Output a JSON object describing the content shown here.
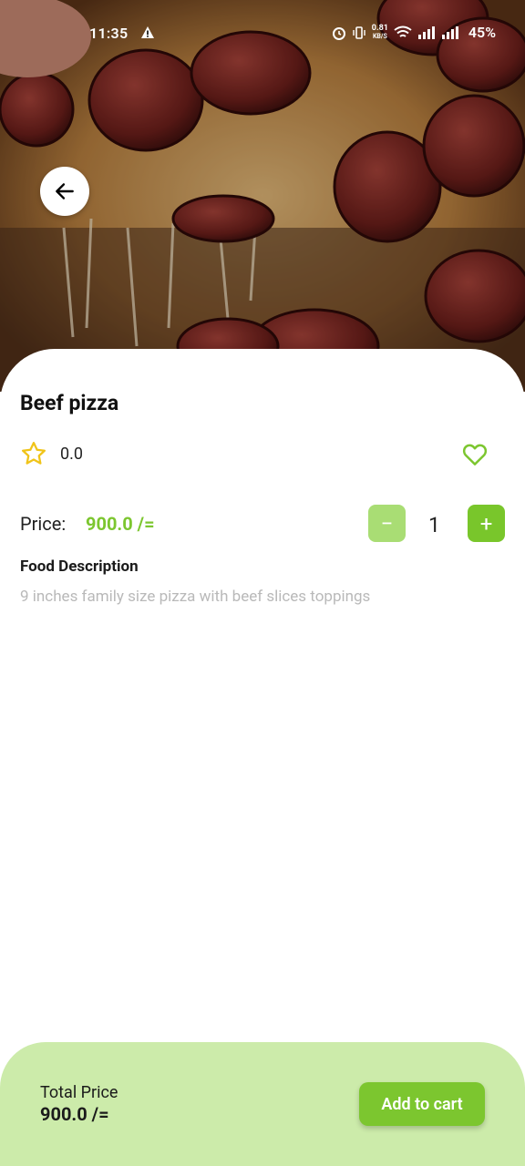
{
  "status_bar": {
    "time": "11:35",
    "network_speed_value": "0.81",
    "network_speed_unit": "KB/S",
    "battery": "45%"
  },
  "product": {
    "name": "Beef pizza",
    "rating": "0.0",
    "price_label": "Price:",
    "price": "900.0 /=",
    "quantity": "1",
    "description_heading": "Food Description",
    "description": "9 inches family size pizza with beef slices toppings"
  },
  "controls": {
    "minus_symbol": "−",
    "plus_symbol": "+"
  },
  "bottom_bar": {
    "total_label": "Total Price",
    "total_value": "900.0 /=",
    "add_to_cart_label": "Add to cart"
  },
  "icons": {
    "back": "arrow-left-icon",
    "rating": "star-outline-icon",
    "favorite": "heart-outline-icon",
    "status_warning": "warning-icon",
    "status_alarm": "alarm-icon",
    "status_vibrate": "vibrate-icon",
    "status_wifi": "wifi-icon",
    "status_signal": "signal-icon"
  },
  "colors": {
    "accent": "#7cc62f",
    "accent_light": "#a9dd74",
    "bottom_bar_bg": "#ccebaa",
    "star": "#f0c419",
    "description_text": "#b9b9b9"
  }
}
